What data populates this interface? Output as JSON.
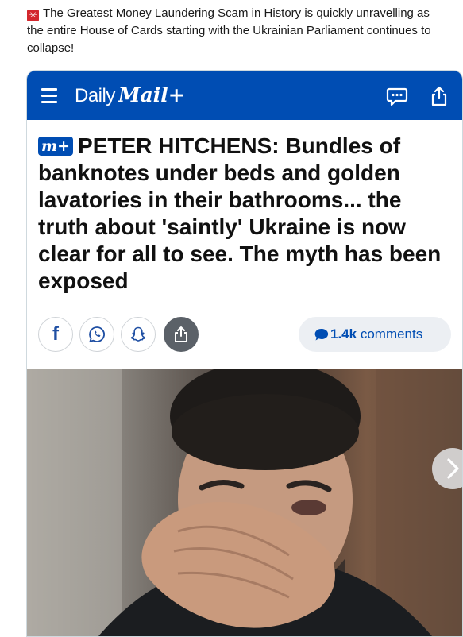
{
  "post": {
    "text": "The Greatest Money Laundering Scam in History is quickly unravelling as the entire House of Cards starting with the Ukrainian Parliament continues to collapse!"
  },
  "header": {
    "brand_daily": "Daily",
    "brand_mail": "Mail+",
    "comment_icon": "comment-icon",
    "share_icon": "share-icon",
    "menu_icon": "hamburger-menu-icon"
  },
  "article": {
    "badge": "m+",
    "headline": "PETER HITCHENS: Bundles of banknotes under beds and golden lavatories in their bathrooms... the truth about 'saintly' Ukraine is now clear for all to see. The myth has been exposed"
  },
  "social": {
    "facebook_letter": "f",
    "comments_count": "1.4k",
    "comments_label": "comments"
  },
  "colors": {
    "brand_blue": "#004db3",
    "flag_red": "#d3272d"
  }
}
